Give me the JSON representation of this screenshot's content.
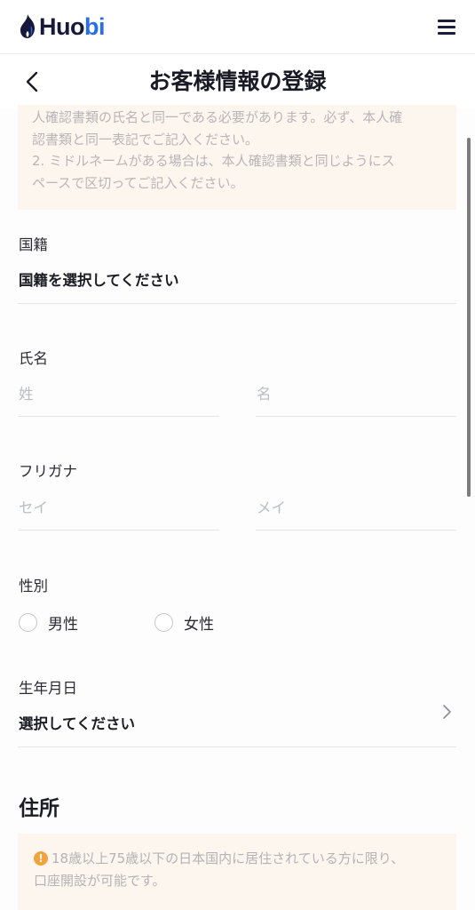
{
  "header": {
    "logo_icon": "flame-icon",
    "logo_text_primary": "Huo",
    "logo_text_accent": "bi",
    "brand_color": "#2b6de8",
    "menu_icon": "hamburger-menu-icon"
  },
  "titlebar": {
    "back_icon": "chevron-left-icon",
    "title": "お客様情報の登録"
  },
  "notice_top": {
    "line1": "人確認書類の氏名と同一である必要があります。必ず、本人確",
    "line2": "認書類と同一表記でご記入ください。",
    "line3": "2. ミドルネームがある場合は、本人確認書類と同じようにス",
    "line4": "ペースで区切ってご記入ください。"
  },
  "form": {
    "nationality": {
      "label": "国籍",
      "value": "国籍を選択してください"
    },
    "name": {
      "label": "氏名",
      "last_placeholder": "姓",
      "first_placeholder": "名"
    },
    "furigana": {
      "label": "フリガナ",
      "last_placeholder": "セイ",
      "first_placeholder": "メイ"
    },
    "gender": {
      "label": "性別",
      "options": [
        "男性",
        "女性"
      ]
    },
    "birthdate": {
      "label": "生年月日",
      "value": "選択してください",
      "chevron_icon": "chevron-right-icon"
    }
  },
  "address": {
    "section_title": "住所",
    "notice_icon": "warning-icon",
    "notice_icon_color": "#f3a33b",
    "notice_line1": "18歳以上75歳以下の日本国内に居住されている方に限り、",
    "notice_line2": "口座開設が可能です。"
  }
}
